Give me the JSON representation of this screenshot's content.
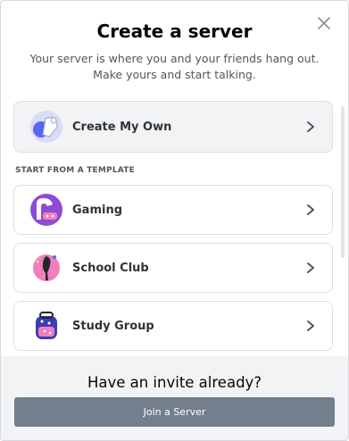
{
  "modal": {
    "title": "Create a server",
    "subtitle": "Your server is where you and your friends hang out. Make yours and start talking.",
    "close_icon": "close-icon"
  },
  "options": {
    "create_own": {
      "label": "Create My Own",
      "icon": "create-own-icon"
    },
    "section_title": "START FROM A TEMPLATE",
    "templates": [
      {
        "label": "Gaming",
        "icon": "gaming-icon"
      },
      {
        "label": "School Club",
        "icon": "school-club-icon"
      },
      {
        "label": "Study Group",
        "icon": "study-group-icon"
      }
    ]
  },
  "footer": {
    "title": "Have an invite already?",
    "join_label": "Join a Server"
  },
  "colors": {
    "button": "#747f8d",
    "footer_bg": "#f2f3f5",
    "gaming_accent": "#8e4bd6",
    "school_accent": "#f17ebd",
    "study_accent": "#3c3fb3"
  }
}
